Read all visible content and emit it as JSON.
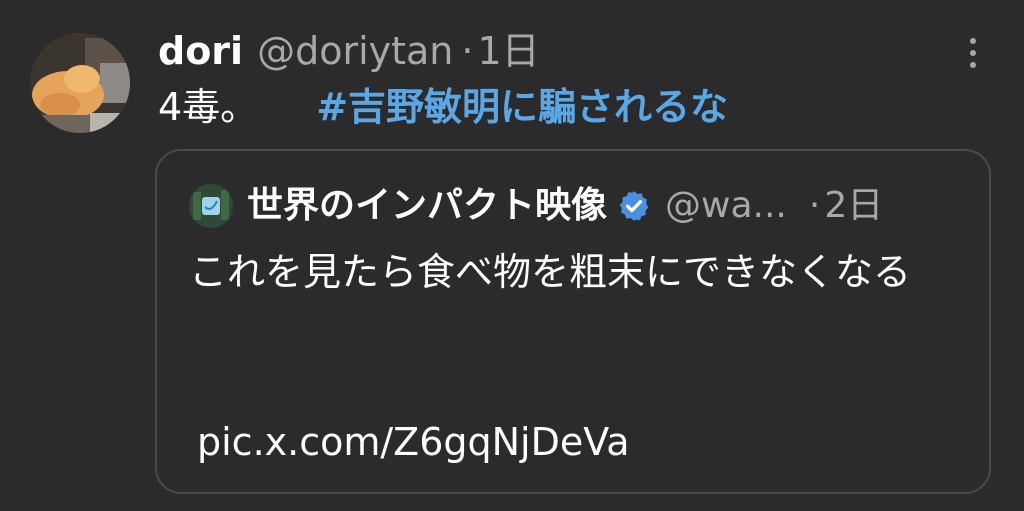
{
  "post": {
    "author": {
      "display_name": "dori",
      "handle": "@doriytan",
      "separator": "·",
      "time": "1日"
    },
    "text": "4毒。",
    "hashtag": "#吉野敏明に騙されるな",
    "more_icon": "more-vertical-icon",
    "quote": {
      "author": {
        "display_name": "世界のインパクト映像",
        "verified_icon": "verified-badge-icon",
        "handle": "@wa...",
        "separator": "·",
        "time": "2日"
      },
      "text": "これを見たら食べ物を粗末にできなくなる",
      "link": "pic.x.com/Z6gqNjDeVa"
    }
  },
  "colors": {
    "background": "#2b2b2b",
    "text": "#ffffff",
    "muted": "#a8a8a8",
    "hashtag": "#5aa7e6",
    "card_border": "#4a4a4a",
    "verified": "#4a90e2"
  }
}
